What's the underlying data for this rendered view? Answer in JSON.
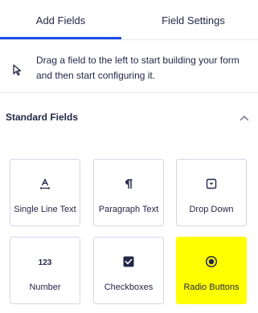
{
  "tabs": {
    "add_fields": "Add Fields",
    "field_settings": "Field Settings"
  },
  "hint": {
    "text": "Drag a field to the left to start building your form and then start configuring it.",
    "icon": "cursor-arrow-icon"
  },
  "section": {
    "title": "Standard Fields",
    "chevron_icon": "chevron-up-icon"
  },
  "fields": [
    {
      "label": "Single Line Text",
      "icon": "text-cursor-icon"
    },
    {
      "label": "Paragraph Text",
      "icon": "paragraph-icon"
    },
    {
      "label": "Drop Down",
      "icon": "dropdown-icon"
    },
    {
      "label": "Number",
      "icon": "number-icon"
    },
    {
      "label": "Checkboxes",
      "icon": "checkbox-icon"
    },
    {
      "label": "Radio Buttons",
      "icon": "radio-icon"
    }
  ],
  "colors": {
    "accent": "#204ce5",
    "text": "#242748",
    "highlight": "#ffff00",
    "border": "#d5d7e9"
  }
}
